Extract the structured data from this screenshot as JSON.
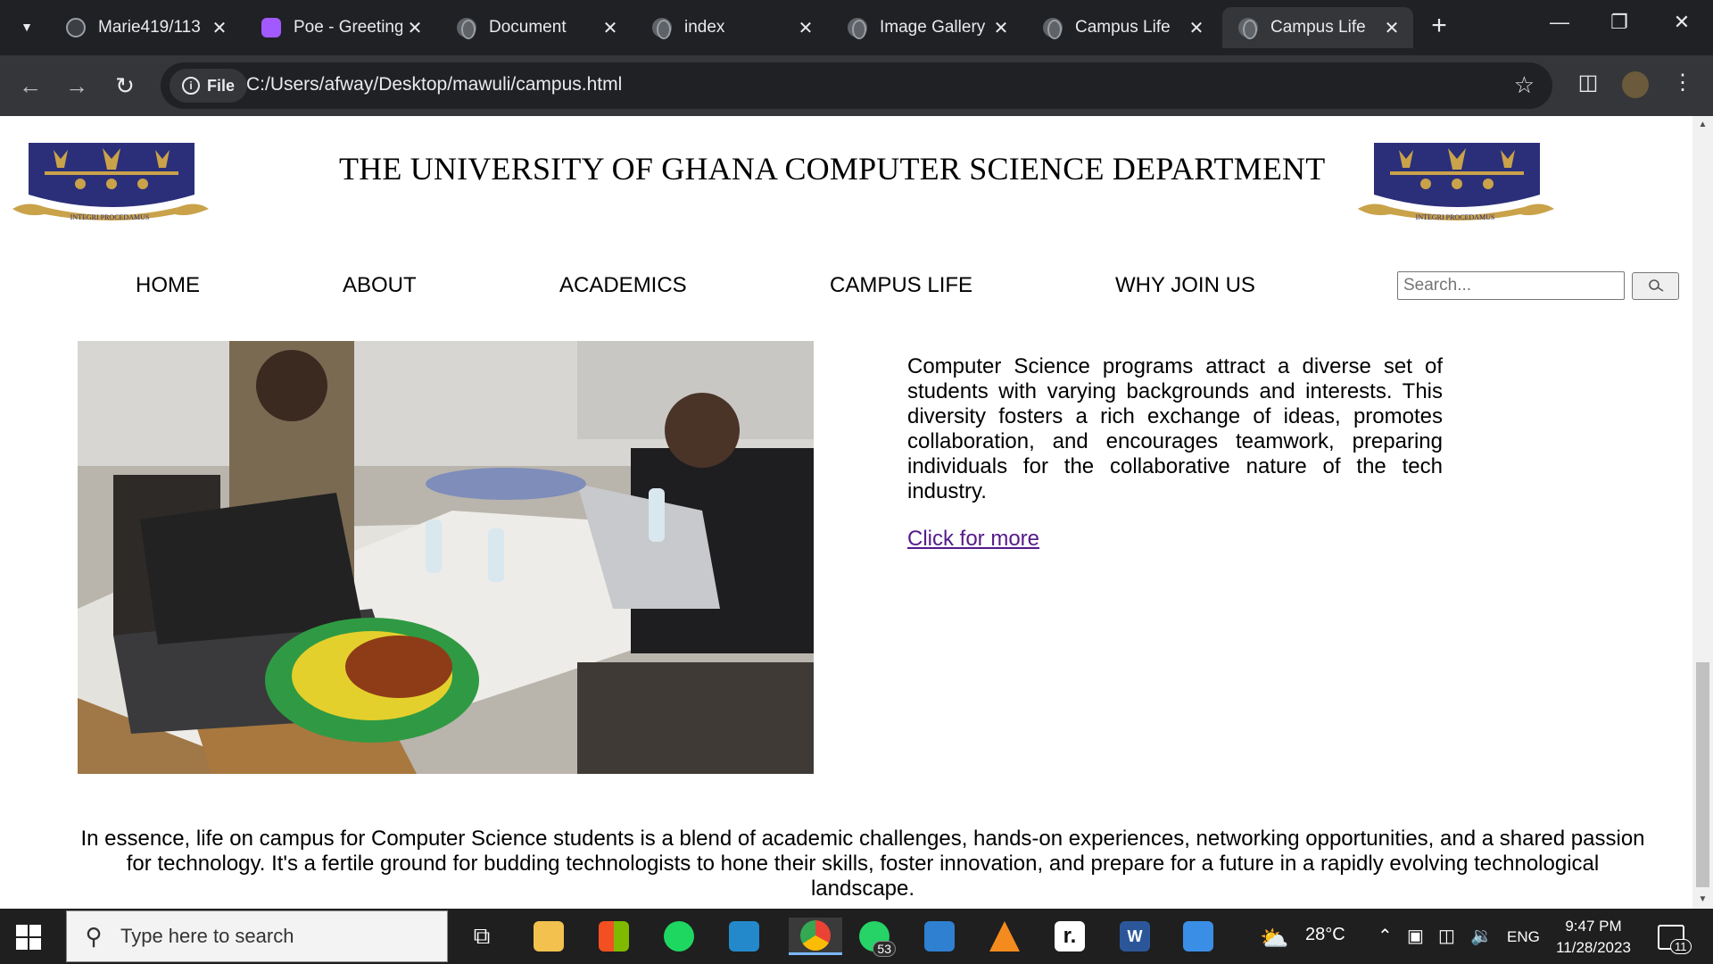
{
  "browser": {
    "tabs": [
      {
        "label": "Marie419/113",
        "favicon": "github-icon",
        "active": false
      },
      {
        "label": "Poe - Greeting",
        "favicon": "poe-icon",
        "active": false
      },
      {
        "label": "Document",
        "favicon": "globe-icon",
        "active": false
      },
      {
        "label": "index",
        "favicon": "globe-icon",
        "active": false
      },
      {
        "label": "Image Gallery",
        "favicon": "globe-icon",
        "active": false
      },
      {
        "label": "Campus Life",
        "favicon": "globe-icon",
        "active": false
      },
      {
        "label": "Campus Life",
        "favicon": "globe-icon",
        "active": true
      }
    ],
    "omnibox": {
      "scheme_label": "File",
      "url": "C:/Users/afway/Desktop/mawuli/campus.html"
    }
  },
  "page": {
    "title": "THE UNIVERSITY OF GHANA COMPUTER SCIENCE DEPARTMENT",
    "crest_motto": "INTEGRI PROCEDAMUS",
    "nav": [
      {
        "label": "HOME"
      },
      {
        "label": "ABOUT"
      },
      {
        "label": "ACADEMICS"
      },
      {
        "label": "CAMPUS LIFE"
      },
      {
        "label": "WHY JOIN US"
      }
    ],
    "search": {
      "placeholder": "Search..."
    },
    "intro_paragraph": "Computer Science programs attract a diverse set of students with varying backgrounds and interests. This diversity fosters a rich exchange of ideas, promotes collaboration, and encourages teamwork, preparing individuals for the collaborative nature of the tech industry.",
    "more_link": "Click for more",
    "closing_paragraph": "In essence, life on campus for Computer Science students is a blend of academic challenges, hands-on experiences, networking opportunities, and a shared passion for technology. It's a fertile ground for budding technologists to hone their skills, foster innovation, and prepare for a future in a rapidly evolving technological landscape."
  },
  "taskbar": {
    "search_placeholder": "Type here to search",
    "whatsapp_badge": "53",
    "weather": "28°C",
    "language": "ENG",
    "time": "9:47 PM",
    "date": "11/28/2023",
    "notification_count": "11"
  },
  "colors": {
    "chrome_dark": "#202124",
    "chrome_toolbar": "#35363a",
    "visited_link": "#551a8b",
    "crest_navy": "#2b2f7a",
    "crest_gold": "#c9a24a"
  }
}
